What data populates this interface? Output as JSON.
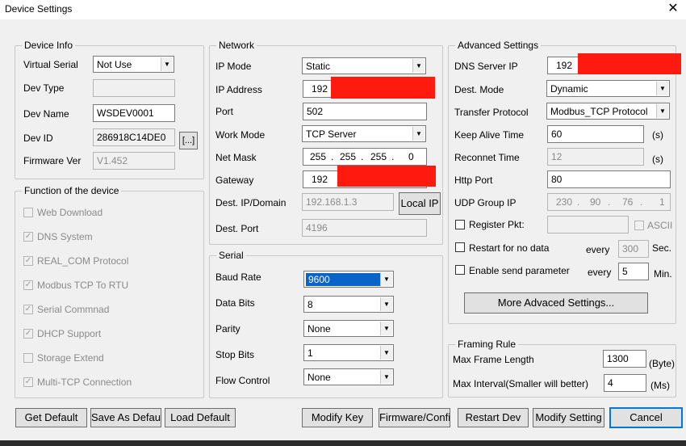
{
  "window": {
    "title": "Device Settings",
    "close": "✕"
  },
  "device_info": {
    "legend": "Device Info",
    "virtual_serial_label": "Virtual Serial",
    "virtual_serial_value": "Not Use",
    "dev_type_label": "Dev Type",
    "dev_type_value": "",
    "dev_name_label": "Dev Name",
    "dev_name_value": "WSDEV0001",
    "dev_id_label": "Dev ID",
    "dev_id_value": "286918C14DE0",
    "dev_id_button": "[...]",
    "firmware_label": "Firmware Ver",
    "firmware_value": "V1.452"
  },
  "functions": {
    "legend": "Function of the device",
    "items": [
      {
        "label": "Web Download",
        "checked": false
      },
      {
        "label": "DNS System",
        "checked": true
      },
      {
        "label": "REAL_COM Protocol",
        "checked": true
      },
      {
        "label": "Modbus TCP To RTU",
        "checked": true
      },
      {
        "label": "Serial Commnad",
        "checked": true
      },
      {
        "label": "DHCP Support",
        "checked": true
      },
      {
        "label": "Storage Extend",
        "checked": false
      },
      {
        "label": "Multi-TCP Connection",
        "checked": true
      }
    ]
  },
  "network": {
    "legend": "Network",
    "ip_mode_label": "IP Mode",
    "ip_mode_value": "Static",
    "ip_address_label": "IP Address",
    "ip_address_value": "192",
    "port_label": "Port",
    "port_value": "502",
    "work_mode_label": "Work Mode",
    "work_mode_value": "TCP Server",
    "net_mask_label": "Net Mask",
    "net_mask": [
      "255",
      "255",
      "255",
      "0"
    ],
    "gateway_label": "Gateway",
    "gateway_value": "192",
    "dest_ip_label": "Dest. IP/Domain",
    "dest_ip_value": "192.168.1.3",
    "local_ip_button": "Local IP",
    "dest_port_label": "Dest. Port",
    "dest_port_value": "4196"
  },
  "serial": {
    "legend": "Serial",
    "baud_rate_label": "Baud Rate",
    "baud_rate_value": "9600",
    "data_bits_label": "Data Bits",
    "data_bits_value": "8",
    "parity_label": "Parity",
    "parity_value": "None",
    "stop_bits_label": "Stop Bits",
    "stop_bits_value": "1",
    "flow_control_label": "Flow Control",
    "flow_control_value": "None"
  },
  "advanced": {
    "legend": "Advanced Settings",
    "dns_label": "DNS Server IP",
    "dns_value": "192",
    "dest_mode_label": "Dest. Mode",
    "dest_mode_value": "Dynamic",
    "transfer_label": "Transfer Protocol",
    "transfer_value": "Modbus_TCP Protocol",
    "keep_alive_label": "Keep Alive Time",
    "keep_alive_value": "60",
    "keep_alive_unit": "(s)",
    "reconnect_label": "Reconnet Time",
    "reconnect_value": "12",
    "reconnect_unit": "(s)",
    "http_port_label": "Http Port",
    "http_port_value": "80",
    "udp_group_label": "UDP Group IP",
    "udp_group": [
      "230",
      "90",
      "76",
      "1"
    ],
    "register_pkt_label": "Register Pkt:",
    "register_pkt_value": "",
    "ascii_label": "ASCII",
    "restart_label": "Restart for no data",
    "restart_every": "every",
    "restart_value": "300",
    "restart_unit": "Sec.",
    "send_param_label": "Enable send parameter",
    "send_param_every": "every",
    "send_param_value": "5",
    "send_param_unit": "Min.",
    "more_button": "More Advaced Settings..."
  },
  "framing": {
    "legend": "Framing Rule",
    "max_len_label": "Max Frame Length",
    "max_len_value": "1300",
    "max_len_unit": "(Byte)",
    "max_interval_label": "Max Interval(Smaller will better)",
    "max_interval_value": "4",
    "max_interval_unit": "(Ms)"
  },
  "buttons": {
    "get_default": "Get Default",
    "save_default": "Save As Default",
    "load_default": "Load Default",
    "modify_key": "Modify Key",
    "firmware_config": "Firmware/Config",
    "restart_dev": "Restart Dev",
    "modify_setting": "Modify Setting",
    "cancel": "Cancel"
  },
  "colors": {
    "redaction": "#ff1a0f",
    "selection": "#0a64c8",
    "dialog_bg": "#f0f0f0"
  }
}
